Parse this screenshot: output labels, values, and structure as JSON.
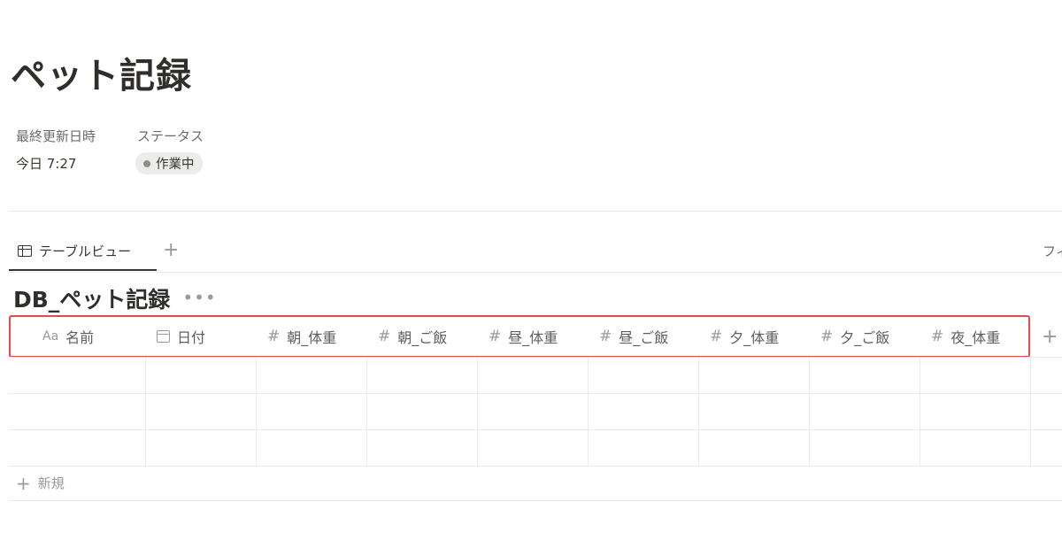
{
  "page": {
    "title": "ペット記録"
  },
  "properties": {
    "last_edited": {
      "name": "最終更新日時",
      "value": "今日 7:27"
    },
    "status": {
      "name": "ステータス",
      "value": "作業中",
      "dot_color": "#8f8e8b"
    }
  },
  "views": {
    "active_tab": {
      "label": "テーブルビュー",
      "icon": "table-icon"
    },
    "add_view_glyph": "+",
    "filter_label": "フィ"
  },
  "database": {
    "title": "DB_ペット記録",
    "more_glyph": "•••",
    "columns": [
      {
        "icon": "text-property-icon",
        "icon_glyph": "Aa",
        "label": "名前"
      },
      {
        "icon": "calendar-icon",
        "icon_glyph": "",
        "label": "日付"
      },
      {
        "icon": "number-icon",
        "icon_glyph": "#",
        "label": "朝_体重"
      },
      {
        "icon": "number-icon",
        "icon_glyph": "#",
        "label": "朝_ご飯"
      },
      {
        "icon": "number-icon",
        "icon_glyph": "#",
        "label": "昼_体重"
      },
      {
        "icon": "number-icon",
        "icon_glyph": "#",
        "label": "昼_ご飯"
      },
      {
        "icon": "number-icon",
        "icon_glyph": "#",
        "label": "夕_体重"
      },
      {
        "icon": "number-icon",
        "icon_glyph": "#",
        "label": "夕_ご飯"
      },
      {
        "icon": "number-icon",
        "icon_glyph": "#",
        "label": "夜_体重"
      }
    ],
    "add_column_glyph": "+",
    "rows": [
      [
        "",
        "",
        "",
        "",
        "",
        "",
        "",
        "",
        ""
      ],
      [
        "",
        "",
        "",
        "",
        "",
        "",
        "",
        "",
        ""
      ],
      [
        "",
        "",
        "",
        "",
        "",
        "",
        "",
        "",
        ""
      ]
    ],
    "new_row_label": "新規",
    "highlight_color": "#e5484d"
  }
}
